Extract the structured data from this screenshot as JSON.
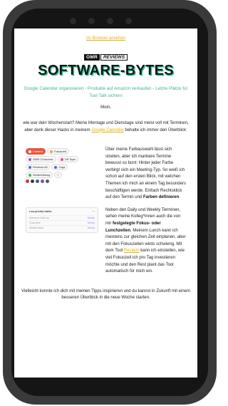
{
  "header": {
    "browser_link": "Im Browser ansehen",
    "logo_omr": "OMR",
    "logo_reviews": "REVIEWS",
    "title": "SOFTWARE-BYTES",
    "subtitle": "Google Calendar organisieren - Produkte auf Amazon verkaufen - Letzte Plätze für Tool Talk sichern"
  },
  "body": {
    "greeting": "Moin,",
    "intro_before": "wie war dein Wochenstart? Meine Montage und Dienstage sind meist voll mit Terminen, aber dank dieser Hacks in meinem ",
    "intro_link": "Google Calendar",
    "intro_after": " behalte ich immer den Überblick:",
    "section1": {
      "chips_line1": [
        "Content",
        "Fokuszeit"
      ],
      "chips_line2": [
        "OMR Crossover",
        "Off Topic"
      ],
      "chips_line3": [
        "Reviews All",
        "Orga"
      ],
      "chips_line4": [
        "Weiterbildung",
        "+"
      ],
      "text_before": "Über meine Farbauswahl lässt sich streiten, aber ich markiere Termine bewusst so bunt: Hinter jeder Farbe verbirgt sich ein Meeting-Typ. So weiß ich schon auf den ersten Blick, mit welchen Themen ich mich an einem Tag besonders beschäftigen werde. Einfach Rechtsklick auf den Termin und ",
      "text_bold": "Farben definieren",
      "text_after": "."
    },
    "section2": {
      "habits_title": "Low-priority habits",
      "habits": [
        {
          "name": "Afternoon Catch Up",
          "meta": "Weekly"
        },
        {
          "name": "Focus time",
          "meta": "Weekly"
        },
        {
          "name": "Weekly Status",
          "meta": "Weekly"
        }
      ],
      "text_before": "Neben den Daily und Weekly Terminen, sehen meine Kolleg*innen auch die von mir ",
      "text_bold": "festgelegte Fokus- oder Lunchzeiten",
      "text_mid": ". Meinem Lunch kann ich meistens zur gleichen Zeit einplanen, aber mit den Fokuszeiten wirds schwierig. Mit dem Tool ",
      "text_link": "Reclaim",
      "text_after": " kann ich einstellen, wie viel Fokuszeit ich pro Tag investieren möchte und den Rest plant das Tool automatisch für mich ein."
    },
    "closing": "Vielleicht konnte ich dich mit meinen Tipps inspirieren und du kannst in Zukunft mit einem besseren Überblick in die neue Woche starten."
  },
  "colors": {
    "accent_teal": "#3ab593",
    "link_yellow": "#e0b000",
    "chip_content": "#e8553f",
    "chip_fokus": "#f2a33a",
    "chip_omr": "#8a63d2",
    "chip_off": "#e84a8a",
    "chip_reviews": "#4f6bd8",
    "chip_orga": "#3a7bd5",
    "chip_weiter": "#3fb36b"
  }
}
